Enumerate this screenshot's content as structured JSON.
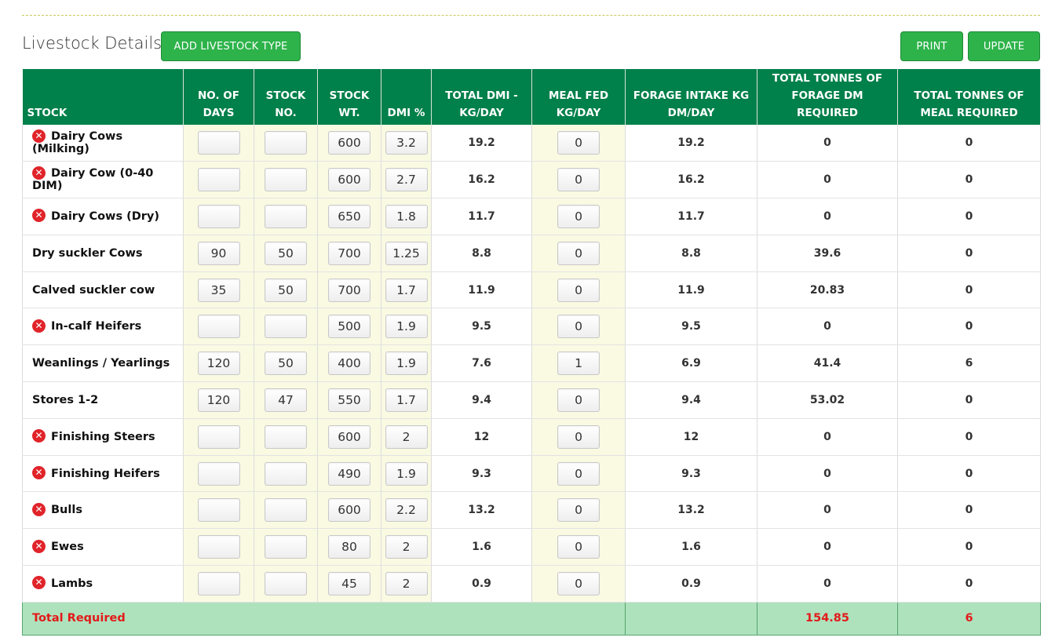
{
  "section": {
    "title": "Livestock Details",
    "add_button": "ADD LIVESTOCK TYPE",
    "print_button": "PRINT",
    "update_button": "UPDATE"
  },
  "headers": {
    "stock": "STOCK",
    "days": "NO. OF DAYS",
    "stock_no": "STOCK NO.",
    "stock_wt": "STOCK WT.",
    "dmi_pct": "DMI %",
    "total_dmi": "TOTAL DMI - KG/DAY",
    "meal_fed": "MEAL FED KG/DAY",
    "forage_intake": "FORAGE INTAKE KG DM/DAY",
    "tonnes_forage": "TOTAL TONNES OF FORAGE DM REQUIRED",
    "tonnes_meal": "TOTAL TONNES OF MEAL REQUIRED"
  },
  "rows": [
    {
      "name": "Dairy Cows (Milking)",
      "removable": true,
      "days": "",
      "stock_no": "",
      "stock_wt": "600",
      "dmi_pct": "3.2",
      "total_dmi": "19.2",
      "meal_fed": "0",
      "forage_intake": "19.2",
      "tonnes_forage": "0",
      "tonnes_meal": "0"
    },
    {
      "name": "Dairy Cow (0-40 DIM)",
      "removable": true,
      "days": "",
      "stock_no": "",
      "stock_wt": "600",
      "dmi_pct": "2.7",
      "total_dmi": "16.2",
      "meal_fed": "0",
      "forage_intake": "16.2",
      "tonnes_forage": "0",
      "tonnes_meal": "0"
    },
    {
      "name": "Dairy Cows (Dry)",
      "removable": true,
      "days": "",
      "stock_no": "",
      "stock_wt": "650",
      "dmi_pct": "1.8",
      "total_dmi": "11.7",
      "meal_fed": "0",
      "forage_intake": "11.7",
      "tonnes_forage": "0",
      "tonnes_meal": "0"
    },
    {
      "name": "Dry suckler Cows",
      "removable": false,
      "days": "90",
      "stock_no": "50",
      "stock_wt": "700",
      "dmi_pct": "1.25",
      "total_dmi": "8.8",
      "meal_fed": "0",
      "forage_intake": "8.8",
      "tonnes_forage": "39.6",
      "tonnes_meal": "0"
    },
    {
      "name": "Calved suckler cow",
      "removable": false,
      "days": "35",
      "stock_no": "50",
      "stock_wt": "700",
      "dmi_pct": "1.7",
      "total_dmi": "11.9",
      "meal_fed": "0",
      "forage_intake": "11.9",
      "tonnes_forage": "20.83",
      "tonnes_meal": "0"
    },
    {
      "name": "In-calf Heifers",
      "removable": true,
      "days": "",
      "stock_no": "",
      "stock_wt": "500",
      "dmi_pct": "1.9",
      "total_dmi": "9.5",
      "meal_fed": "0",
      "forage_intake": "9.5",
      "tonnes_forage": "0",
      "tonnes_meal": "0"
    },
    {
      "name": "Weanlings / Yearlings",
      "removable": false,
      "days": "120",
      "stock_no": "50",
      "stock_wt": "400",
      "dmi_pct": "1.9",
      "total_dmi": "7.6",
      "meal_fed": "1",
      "forage_intake": "6.9",
      "tonnes_forage": "41.4",
      "tonnes_meal": "6"
    },
    {
      "name": "Stores 1-2",
      "removable": false,
      "days": "120",
      "stock_no": "47",
      "stock_wt": "550",
      "dmi_pct": "1.7",
      "total_dmi": "9.4",
      "meal_fed": "0",
      "forage_intake": "9.4",
      "tonnes_forage": "53.02",
      "tonnes_meal": "0"
    },
    {
      "name": "Finishing Steers",
      "removable": true,
      "days": "",
      "stock_no": "",
      "stock_wt": "600",
      "dmi_pct": "2",
      "total_dmi": "12",
      "meal_fed": "0",
      "forage_intake": "12",
      "tonnes_forage": "0",
      "tonnes_meal": "0"
    },
    {
      "name": "Finishing Heifers",
      "removable": true,
      "days": "",
      "stock_no": "",
      "stock_wt": "490",
      "dmi_pct": "1.9",
      "total_dmi": "9.3",
      "meal_fed": "0",
      "forage_intake": "9.3",
      "tonnes_forage": "0",
      "tonnes_meal": "0"
    },
    {
      "name": "Bulls",
      "removable": true,
      "days": "",
      "stock_no": "",
      "stock_wt": "600",
      "dmi_pct": "2.2",
      "total_dmi": "13.2",
      "meal_fed": "0",
      "forage_intake": "13.2",
      "tonnes_forage": "0",
      "tonnes_meal": "0"
    },
    {
      "name": "Ewes",
      "removable": true,
      "days": "",
      "stock_no": "",
      "stock_wt": "80",
      "dmi_pct": "2",
      "total_dmi": "1.6",
      "meal_fed": "0",
      "forage_intake": "1.6",
      "tonnes_forage": "0",
      "tonnes_meal": "0"
    },
    {
      "name": "Lambs",
      "removable": true,
      "days": "",
      "stock_no": "",
      "stock_wt": "45",
      "dmi_pct": "2",
      "total_dmi": "0.9",
      "meal_fed": "0",
      "forage_intake": "0.9",
      "tonnes_forage": "0",
      "tonnes_meal": "0"
    }
  ],
  "total": {
    "label": "Total Required",
    "tonnes_forage": "154.85",
    "tonnes_meal": "6"
  },
  "colors": {
    "header_bg": "#00804a",
    "button_bg": "#2db34a",
    "total_bg": "#aee2bd",
    "total_text": "#e21a1a",
    "remove_icon": "#e0242a",
    "input_column_bg": "#fafae3"
  }
}
